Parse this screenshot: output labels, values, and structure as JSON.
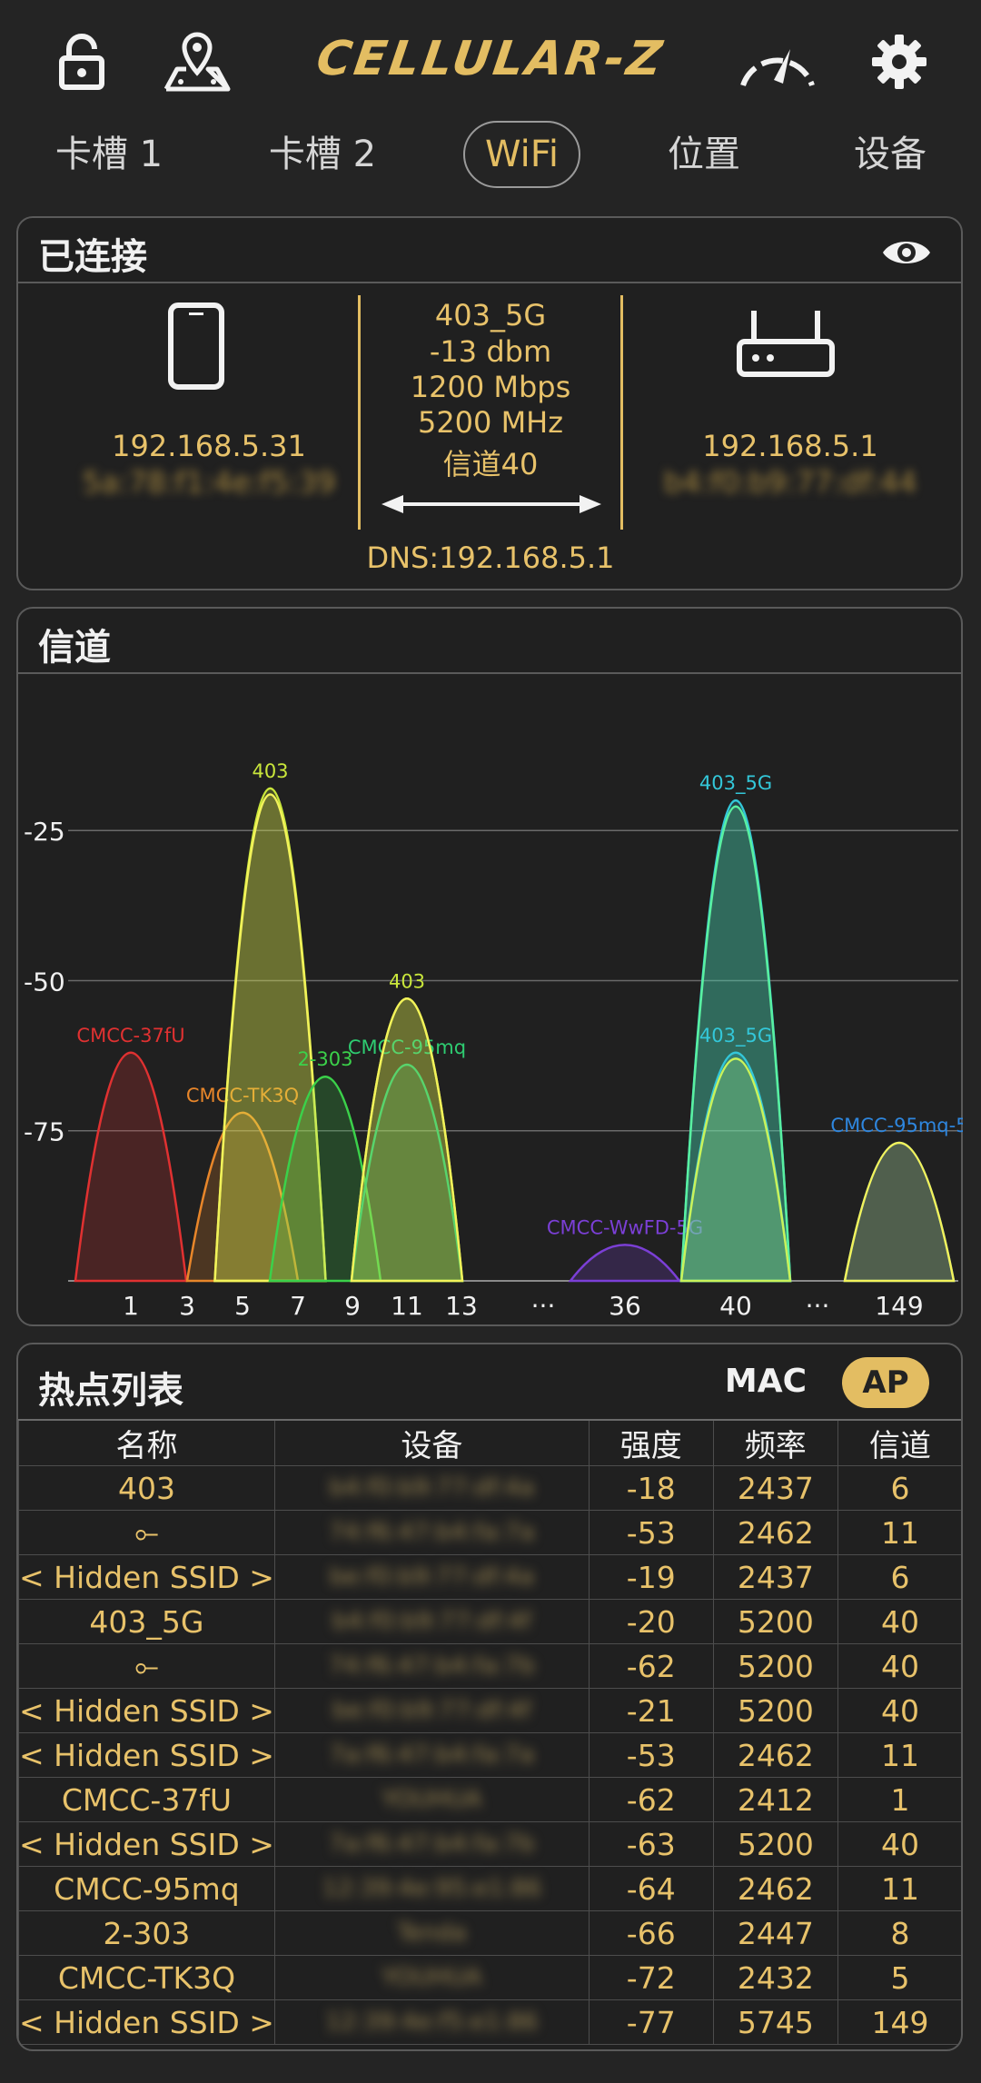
{
  "app": {
    "title": "CELLULAR-Z"
  },
  "tabs": [
    {
      "label": "卡槽 1"
    },
    {
      "label": "卡槽 2"
    },
    {
      "label": "WiFi"
    },
    {
      "label": "位置"
    },
    {
      "label": "设备"
    }
  ],
  "connected": {
    "title": "已连接",
    "phone_ip": "192.168.5.31",
    "phone_mac": "5a:78:f1:4e:f5:39",
    "router_ip": "192.168.5.1",
    "router_mac": "b4:f0:b9:77:df:44",
    "ssid": "403_5G",
    "signal": "-13 dbm",
    "speed": "1200 Mbps",
    "freq": "5200 MHz",
    "channel": "信道40",
    "dns": "DNS:192.168.5.1"
  },
  "channel_panel": {
    "title": "信道"
  },
  "chart_data": {
    "type": "area",
    "y_ticks": [
      -25,
      -50,
      -75
    ],
    "ylim": [
      -100,
      -5
    ],
    "x_ticks": [
      "1",
      "3",
      "5",
      "7",
      "9",
      "11",
      "13",
      "···",
      "36",
      "40",
      "···",
      "149"
    ],
    "series": [
      {
        "name": "CMCC-37fU",
        "channel": "1",
        "value": -62,
        "color": "#e03131"
      },
      {
        "name": "CMCC-TK3Q",
        "channel": "5",
        "value": -72,
        "color": "#e8862a"
      },
      {
        "name": "403",
        "channel": "6",
        "value": -18,
        "color": "#c9e63b"
      },
      {
        "name": "",
        "channel": "6",
        "value": -19,
        "color": "#f2f25a"
      },
      {
        "name": "2-303",
        "channel": "8",
        "value": -66,
        "color": "#3bd14a"
      },
      {
        "name": "403",
        "channel": "11",
        "value": -53,
        "color": "#c9e63b"
      },
      {
        "name": "CMCC-95mq",
        "channel": "11",
        "value": -64,
        "color": "#2ecc71"
      },
      {
        "name": "",
        "channel": "11",
        "value": -53,
        "color": "#f2f25a"
      },
      {
        "name": "CMCC-WwFD-5G",
        "channel": "36",
        "value": -94,
        "color": "#7b3fd6"
      },
      {
        "name": "403_5G",
        "channel": "40",
        "value": -20,
        "color": "#33c7d9"
      },
      {
        "name": "",
        "channel": "40",
        "value": -21,
        "color": "#59f0a0"
      },
      {
        "name": "403_5G",
        "channel": "40",
        "value": -62,
        "color": "#33c7d9"
      },
      {
        "name": "",
        "channel": "40",
        "value": -63,
        "color": "#c9f25a"
      },
      {
        "name": "CMCC-95mq-5",
        "channel": "149",
        "value": -77,
        "color": "#2e86de"
      },
      {
        "name": "",
        "channel": "149",
        "value": -77,
        "color": "#f2f25a"
      }
    ]
  },
  "hotspots": {
    "title": "热点列表",
    "toggle_mac": "MAC",
    "toggle_ap": "AP",
    "columns": [
      "名称",
      "设备",
      "强度",
      "频率",
      "信道"
    ],
    "rows": [
      [
        "403",
        "b4:f0:b9:77:df:4a",
        "-18",
        "2437",
        "6"
      ],
      [
        "⟜",
        "74:f6:47:b4:fa:7a",
        "-53",
        "2462",
        "11"
      ],
      [
        "< Hidden SSID >",
        "be:f0:b9:77:df:4a",
        "-19",
        "2437",
        "6"
      ],
      [
        "403_5G",
        "b4:f0:b9:77:df:4f",
        "-20",
        "5200",
        "40"
      ],
      [
        "⟜",
        "74:f6:47:b4:fa:7b",
        "-62",
        "5200",
        "40"
      ],
      [
        "< Hidden SSID >",
        "be:f0:b9:77:df:4f",
        "-21",
        "5200",
        "40"
      ],
      [
        "< Hidden SSID >",
        "7a:f6:47:b4:fa:7a",
        "-53",
        "2462",
        "11"
      ],
      [
        "CMCC-37fU",
        "YOUHUA",
        "-62",
        "2412",
        "1"
      ],
      [
        "< Hidden SSID >",
        "7a:f6:47:b4:fa:7b",
        "-63",
        "5200",
        "40"
      ],
      [
        "CMCC-95mq",
        "12:39:4e:95:e1:86",
        "-64",
        "2462",
        "11"
      ],
      [
        "2-303",
        "Tenda",
        "-66",
        "2447",
        "8"
      ],
      [
        "CMCC-TK3Q",
        "YOUHUA",
        "-72",
        "2432",
        "5"
      ],
      [
        "< Hidden SSID >",
        "12:39:4e:f5:e1:86",
        "-77",
        "5745",
        "149"
      ]
    ]
  }
}
